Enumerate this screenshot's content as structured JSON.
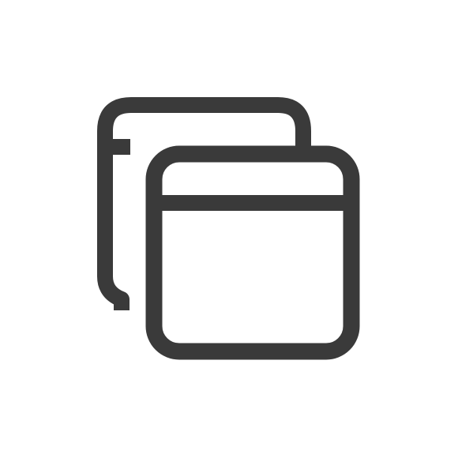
{
  "icon": {
    "name": "multiple-windows-icon",
    "stroke_color": "#3a3a3a",
    "background_color": "#ffffff"
  }
}
